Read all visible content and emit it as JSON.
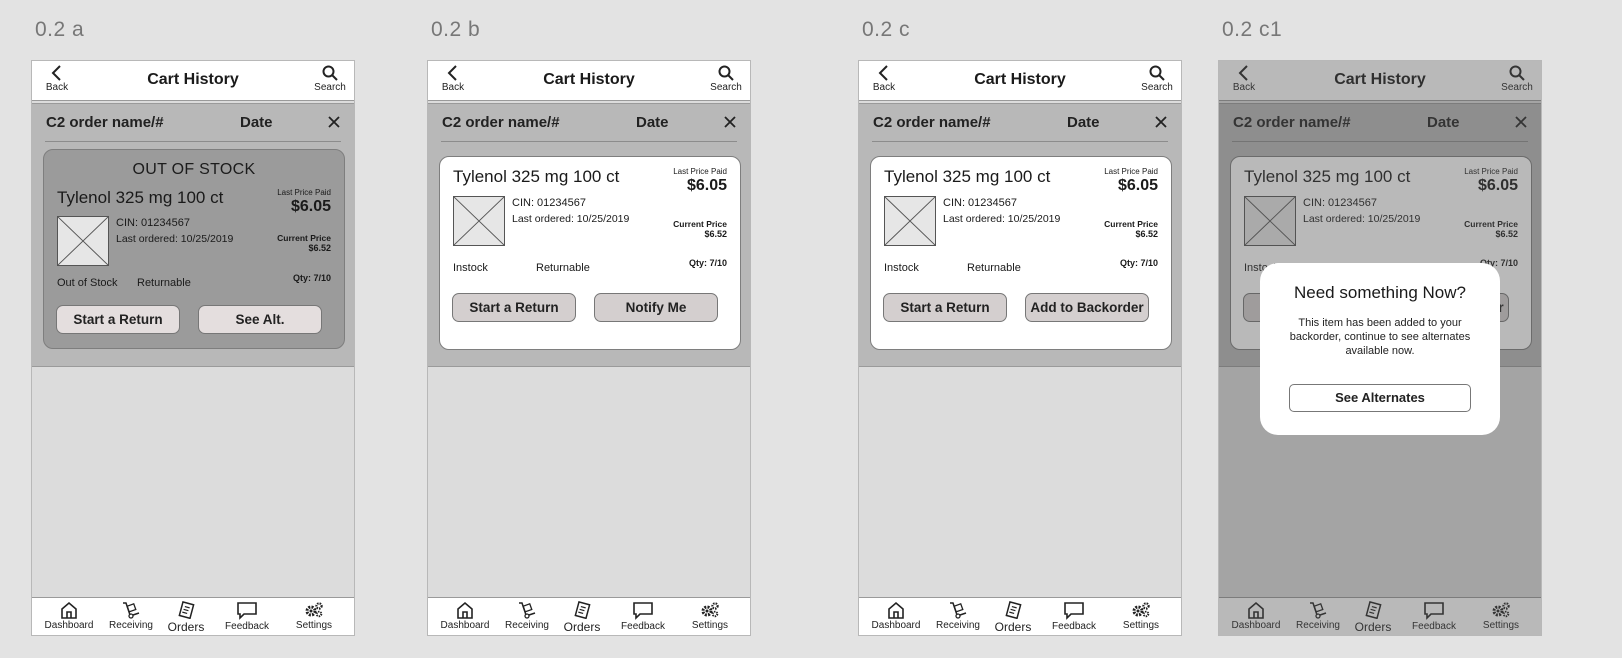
{
  "header": {
    "back_label": "Back",
    "title": "Cart History",
    "search_label": "Search"
  },
  "order_row": {
    "name": "C2 order name/#",
    "date": "Date"
  },
  "product": {
    "name": "Tylenol 325 mg 100 ct",
    "last_price_label": "Last Price Paid",
    "last_price": "$6.05",
    "cin": "CIN: 01234567",
    "last_ordered": "Last ordered: 10/25/2019",
    "current_price_label": "Current Price",
    "current_price": "$6.52",
    "qty": "Qty: 7/10",
    "returnable": "Returnable"
  },
  "tabbar": {
    "dashboard": "Dashboard",
    "receiving": "Receiving",
    "orders": "Orders",
    "feedback": "Feedback",
    "settings": "Settings"
  },
  "frames": {
    "a": {
      "label": "0.2 a",
      "out_of_stock_title": "OUT OF STOCK",
      "stock_status": "Out of Stock",
      "btn_left": "Start a Return",
      "btn_right": "See Alt."
    },
    "b": {
      "label": "0.2 b",
      "stock_status": "Instock",
      "btn_left": "Start a Return",
      "btn_right": "Notify Me"
    },
    "c": {
      "label": "0.2 c",
      "stock_status": "Instock",
      "btn_left": "Start a Return",
      "btn_right": "Add to Backorder"
    },
    "c1": {
      "label": "0.2 c1",
      "stock_status": "Instock",
      "modal_title": "Need something Now?",
      "modal_body": "This item has been added to your backorder, continue to see alternates available now.",
      "modal_button": "See Alternates"
    }
  },
  "colors": {
    "background": "#e3e3e3",
    "phone_bg": "#dcdcdc",
    "sheet_bg": "#b8b8b8",
    "oos_card_bg": "#9b9b9b",
    "button_bg": "#d4cfcf"
  },
  "icons": [
    "chevron-left-icon",
    "search-icon",
    "close-icon",
    "product-placeholder-icon",
    "home-icon",
    "hand-truck-icon",
    "clipboard-icon",
    "chat-bubble-icon",
    "gears-icon"
  ]
}
